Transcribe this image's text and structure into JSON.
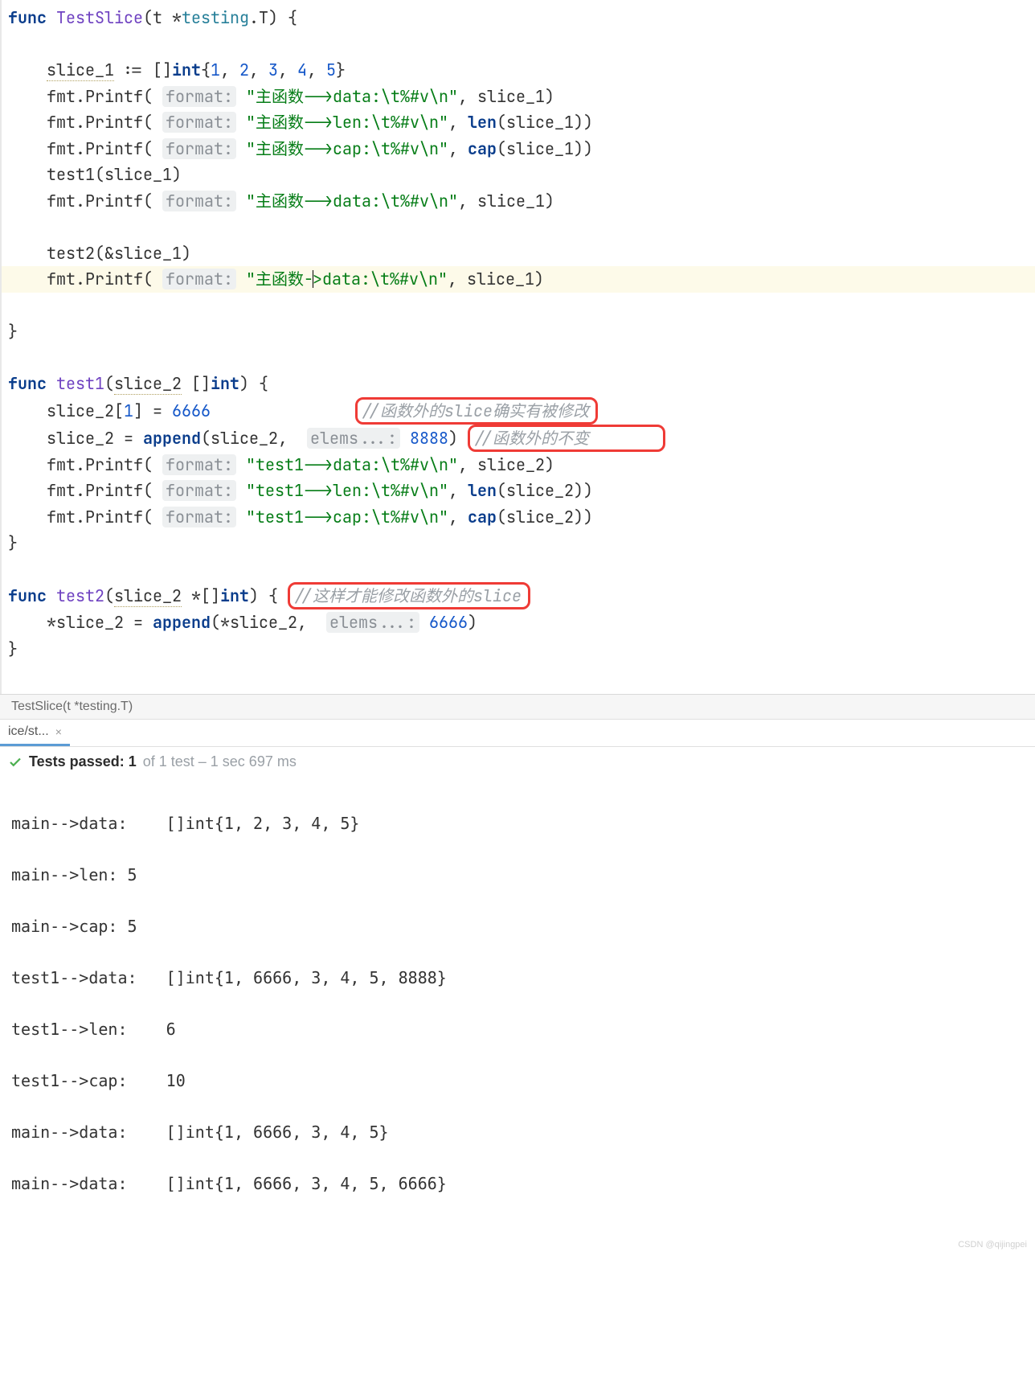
{
  "editor": {
    "func_kw": "func",
    "testslice_name": "TestSlice",
    "param_open": "(t *",
    "testing_pkg": "testing",
    "testing_T": ".T) {",
    "slice1_decl_a": "slice_1",
    "slice1_decl_b": " := []",
    "int_kw": "int",
    "slice1_vals": "{1, 2, 3, 4, 5}",
    "n1": "1",
    "n2": "2",
    "n3": "3",
    "n4": "4",
    "n5": "5",
    "fmt": "fmt",
    "printf": ".Printf(",
    "format_hint": "format:",
    "str_main_data": "\"主函数-->data:\\t%#v\\n\"",
    "str_main_data_cursor_a": "\"主函数-",
    "str_main_data_cursor_b": ">data:\\t%#v\\n\"",
    "str_main_len": "\"主函数-->len:\\t%#v\\n\"",
    "str_main_cap": "\"主函数-->cap:\\t%#v\\n\"",
    "slice1_arg": ", slice_1)",
    "len_call": "len",
    "cap_call": "cap",
    "len_arg": "(slice_1))",
    "cap_arg": "(slice_1))",
    "test1_call": "test1(slice_1)",
    "test2_call": "test2(&slice_1)",
    "close_brace": "}",
    "test1_sig_a": "test1(",
    "test1_sig_b": "slice_2",
    "test1_sig_c": " []",
    "test1_sig_d": ") {",
    "line_t1_a": "slice_2[",
    "line_t1_b": "] = ",
    "num_1": "1",
    "num_6666": "6666",
    "cmt1": "//函数外的slice确实有被修改",
    "append_a": "slice_2 = ",
    "append_fn": "append",
    "append_b": "(slice_2, ",
    "elems_hint": "elems...:",
    "num_8888": "8888",
    "append_c": ")",
    "cmt2": "//函数外的不变",
    "str_t1_data": "\"test1-->data:\\t%#v\\n\"",
    "str_t1_len": "\"test1-->len:\\t%#v\\n\"",
    "str_t1_cap": "\"test1-->cap:\\t%#v\\n\"",
    "slice2_arg": ", slice_2)",
    "len2_arg": "(slice_2))",
    "cap2_arg": "(slice_2))",
    "test2_sig_a": "test2(",
    "test2_sig_b": "slice_2",
    "test2_sig_c": " *[]",
    "test2_sig_d": ") {",
    "cmt3": "//这样才能修改函数外的slice",
    "t2_body_a": "*slice_2 = ",
    "t2_body_b": "(*slice_2,  ",
    "t2_body_c": ")"
  },
  "breadcrumb": "TestSlice(t *testing.T)",
  "tab": {
    "label": "ice/st...",
    "close": "×"
  },
  "tests": {
    "check": "✓",
    "passed_prefix": "Tests passed: 1",
    "rest": " of 1 test – 1 sec 697 ms"
  },
  "console": [
    "main-->data:    []int{1, 2, 3, 4, 5}",
    "main-->len: 5",
    "main-->cap: 5",
    "test1-->data:   []int{1, 6666, 3, 4, 5, 8888}",
    "test1-->len:    6",
    "test1-->cap:    10",
    "main-->data:    []int{1, 6666, 3, 4, 5}",
    "main-->data:    []int{1, 6666, 3, 4, 5, 6666}"
  ],
  "watermark": "CSDN @qijingpei"
}
